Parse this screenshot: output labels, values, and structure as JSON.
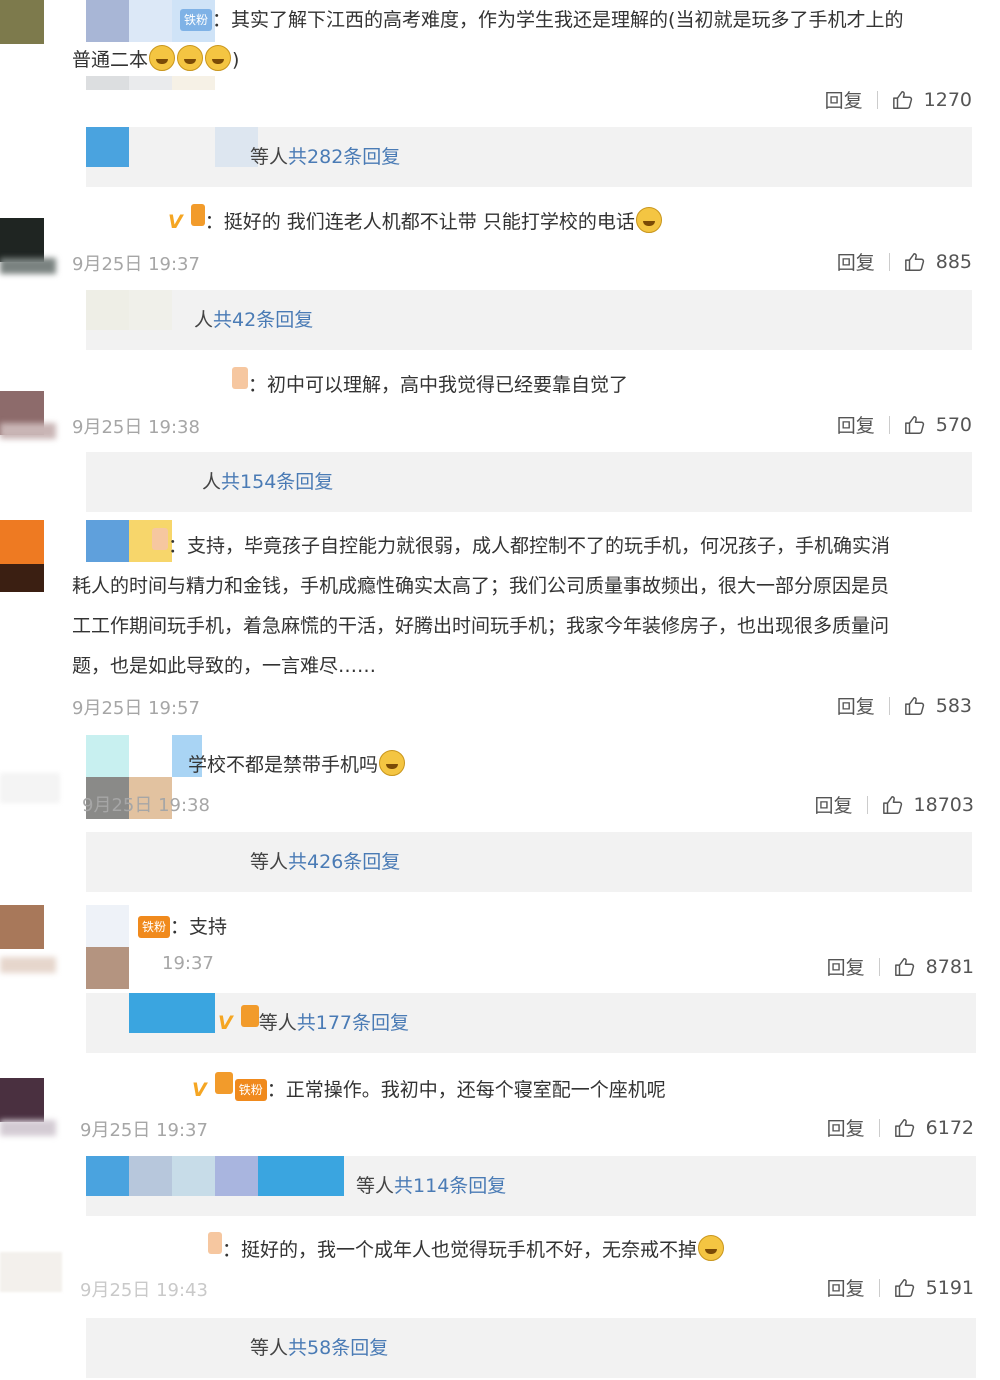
{
  "colors": {
    "link": "#4a7bb5",
    "bar": "#f2f2f2",
    "meta": "#a6a6a6"
  },
  "icons": {
    "like": "thumbs-up-icon",
    "emoji": "emoji-face-icon"
  },
  "comments": [
    {
      "name_badge": "铁粉",
      "text_l1": "其实了解下江西的高考难度，作为学生我还是理解的(当初就是玩多了手机才上的",
      "text_l2": "普通二本",
      "text_l2_end": ")",
      "time": "9月25日 19:37",
      "reply": "回复",
      "likes": "1270",
      "more_suffix": "等人",
      "more_link": "共282条回复"
    },
    {
      "text": "挺好的 我们连老人机都不让带 只能打学校的电话",
      "time": "9月25日 19:37",
      "reply": "回复",
      "likes": "885",
      "more_suffix": "人",
      "more_link": "共42条回复"
    },
    {
      "text": "初中可以理解，高中我觉得已经要靠自觉了",
      "time": "9月25日 19:38",
      "reply": "回复",
      "likes": "570",
      "more_suffix": "人",
      "more_link": "共154条回复"
    },
    {
      "text_l1": "支持，毕竟孩子自控能力就很弱，成人都控制不了的玩手机，何况孩子，手机确实消",
      "text_l2": "耗人的时间与精力和金钱，手机成瘾性确实太高了；我们公司质量事故频出，很大一部分原因是员",
      "text_l3": "工工作期间玩手机，着急麻慌的干活，好腾出时间玩手机；我家今年装修房子，也出现很多质量问",
      "text_l4": "题，也是如此导致的，一言难尽……",
      "time": "9月25日 19:57",
      "reply": "回复",
      "likes": "583"
    },
    {
      "text": "学校不都是禁带手机吗",
      "time": "9月25日 19:38",
      "reply": "回复",
      "likes": "18703",
      "more_suffix": "等人",
      "more_link": "共426条回复"
    },
    {
      "name_badge": "铁粉",
      "text": "支持",
      "time": "19:37",
      "reply": "回复",
      "likes": "8781",
      "more_suffix": "等人",
      "more_link": "共177条回复"
    },
    {
      "name_badge": "铁粉",
      "text": "正常操作。我初中，还每个寝室配一个座机呢",
      "time": "9月25日 19:37",
      "reply": "回复",
      "likes": "6172",
      "more_suffix": "等人",
      "more_link": "共114条回复"
    },
    {
      "text": "挺好的，我一个成年人也觉得玩手机不好，无奈戒不掉",
      "time": "9月25日 19:43",
      "reply": "回复",
      "likes": "5191",
      "more_suffix": "等人",
      "more_link": "共58条回复"
    }
  ]
}
